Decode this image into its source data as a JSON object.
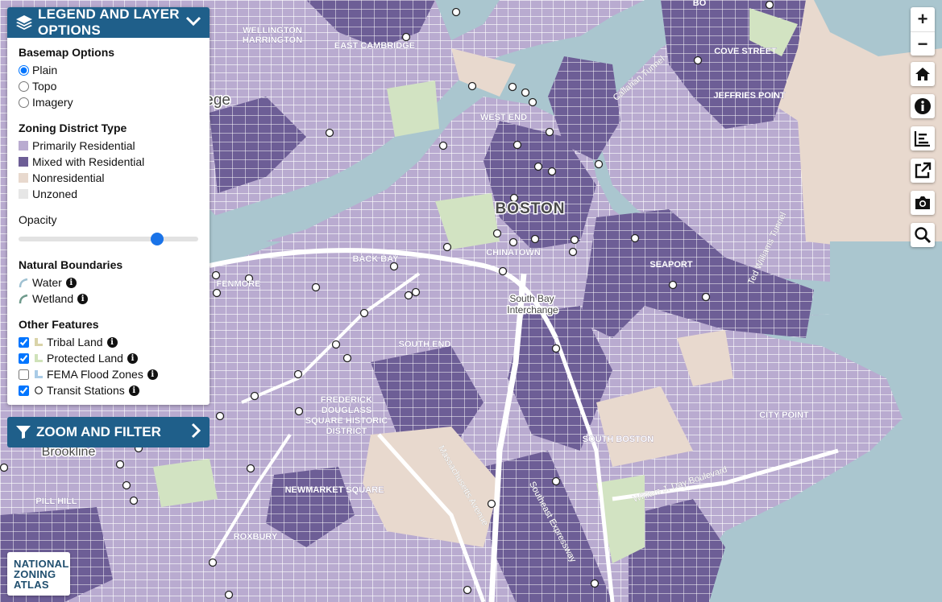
{
  "legend": {
    "header_title": "Legend and Layer Options",
    "basemap_title": "Basemap Options",
    "basemap_options": [
      "Plain",
      "Topo",
      "Imagery"
    ],
    "basemap_selected": "Plain",
    "zoning_title": "Zoning District Type",
    "zoning_types": [
      {
        "label": "Primarily Residential",
        "color": "#b9abd0"
      },
      {
        "label": "Mixed with Residential",
        "color": "#6d5e96"
      },
      {
        "label": "Nonresidential",
        "color": "#e8d9ce"
      },
      {
        "label": "Unzoned",
        "color": "#e6e6e6"
      }
    ],
    "opacity_label": "Opacity",
    "opacity_value": 0.77,
    "natural_title": "Natural Boundaries",
    "natural_items": [
      {
        "label": "Water",
        "color": "#9fc1d2"
      },
      {
        "label": "Wetland",
        "color": "#6f9a8c"
      }
    ],
    "other_title": "Other Features",
    "other_items": [
      {
        "label": "Tribal Land",
        "checked": true,
        "color": "#d9d3a8"
      },
      {
        "label": "Protected Land",
        "checked": true,
        "color": "#cfe2b9"
      },
      {
        "label": "FEMA Flood Zones",
        "checked": false,
        "color": "#a9cbe6"
      },
      {
        "label": "Transit Stations",
        "checked": true,
        "color": "#ffffff"
      }
    ]
  },
  "zoom_filter": {
    "title": "Zoom and Filter"
  },
  "controls": {
    "zoom_in": "+",
    "zoom_out": "−",
    "icons": [
      "home-icon",
      "info-icon",
      "chart-icon",
      "share-icon",
      "camera-icon",
      "search-icon"
    ]
  },
  "logo": {
    "line1": "NATIONAL",
    "line2": "ZONING",
    "line3": "ATLAS"
  },
  "map_labels": {
    "boston": "BOSTON",
    "wellington": "WELLINGTON",
    "harrington": "HARRINGTON",
    "east_cambridge": "EAST CAMBRIDGE",
    "west_end": "WEST END",
    "back_bay": "BACK BAY",
    "chinatown": "CHINATOWN",
    "seaport": "SEAPORT",
    "south_bay": "South Bay",
    "interchange": "Interchange",
    "south_end": "SOUTH END",
    "fenmore": "FENMORE",
    "frederick": "FREDERICK",
    "douglass": "DOUGLASS",
    "square_historic": "SQUARE HISTORIC",
    "district": "DISTRICT",
    "brookline": "Brookline",
    "city_point": "CITY POINT",
    "south_boston": "SOUTH BOSTON",
    "pill_hill": "PILL HILL",
    "roxbury": "ROXBURY",
    "cove_street": "COVE STREET",
    "jeffries_point": "JEFFRIES POINT",
    "sumner_tunnel": "Callahan Tunnel",
    "ted_williams": "Ted Williams Tunnel",
    "william_day": "William J. Day Boulevard",
    "mass_ave": "Massachusetts Avenue",
    "southeast_exp": "Southeast Expressway",
    "lege": "lege",
    "newmarket": "NEWMARKET SQUARE",
    "bo": "BO"
  }
}
